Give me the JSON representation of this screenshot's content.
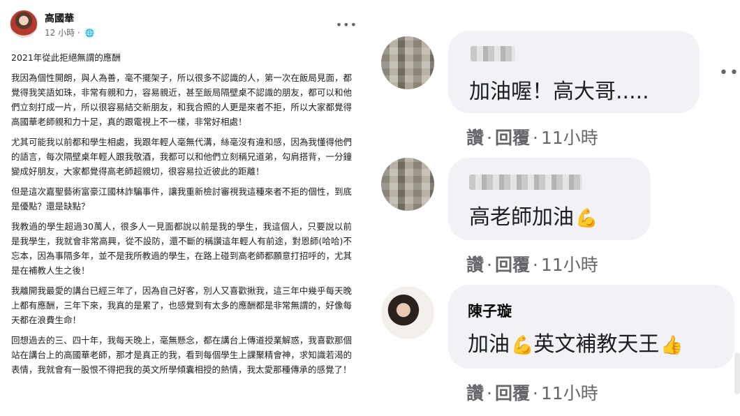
{
  "post": {
    "author": "高國華",
    "time": "12 小時",
    "globe_icon": "globe-icon",
    "title": "2021年從此拒絕無謂的應酬",
    "paragraphs": [
      "我因為個性開朗，與人為善，毫不擺架子，所以很多不認識的人，第一次在飯局見面，都覺得我笑語如珠，非常有親和力，容易親近，甚至飯局隔壁桌不認識的朋友，都可以和他們立刻打成一片，所以很容易結交新朋友，和我合照的人更是來者不拒，所以大家都覺得高國華老師親和力十足，真的跟電視上不一樣，非常好相處！",
      "尤其可能我以前都和學生相處，我跟年輕人毫無代溝，絲毫沒有違和感，因為我懂得他們的語言，每次隔壁桌年輕人跟我敬酒，我都可以和他們立刻稱兄道弟，勾肩搭背，一分鐘變成好朋友，大家都覺得高老師超親切，很容易拉近彼此的距離！",
      "但是這次嘉聖藝術富豪江國林詐騙事件，讓我重新檢討審視我這種來者不拒的個性，到底是優點？還是缺點？",
      "我教過的學生超過30萬人，很多人一見面都說以前是我的學生，我這個人，只要說以前是我學生，我就會非常高興，從不設防，還不斷的稱讚這年輕人有前途，對恩師(哈哈)不忘本，因為事隔多年，並不是我所教過的學生，在路上碰到高老師都願意打招呼的，尤其是在補教人生之後！",
      "我離開我最愛的講台已經三年了，因為自己好客，別人又喜歡揪我，這三年中幾乎每天晚上都有應酬，三年下來，我真的是累了，也感覺到有太多的應酬都是非常無謂的，好像每天都在浪費生命！",
      "回想過去的三、四十年，我每天晚上，毫無懸念，都在講台上傳道授業解惑，我喜歡那個站在講台上的高國華老師，那才是真正的我，看到每個學生上課聚精會神，求知識若渴的表情，我就會有一股恨不得把我的英文所學傾囊相授的熱情，我太愛那種傳承的感覺了！"
    ]
  },
  "comments": [
    {
      "avatar_icon": "blurred-avatar",
      "name": "",
      "text": "加油喔！高大哥.....",
      "emojis": [],
      "like_label": "讚",
      "reply_label": "回覆",
      "time": "11小時"
    },
    {
      "avatar_icon": "blurred-avatar",
      "name": "",
      "text": "高老師加油",
      "emojis": [
        "flexed-biceps-icon"
      ],
      "like_label": "讚",
      "reply_label": "回覆",
      "time": "11小時"
    },
    {
      "avatar_icon": "profile-photo",
      "name": "陳子璇",
      "text_part1": "加油",
      "text_part2": "英文補教天王",
      "emojis": [
        "flexed-biceps-icon",
        "thumbs-up-icon"
      ],
      "like_label": "讚",
      "reply_label": "回覆",
      "time": "11小時"
    }
  ],
  "colors": {
    "bubble": "#f0f2f5",
    "secondary_text": "#65676b",
    "emoji_yellow": "#f5b70a"
  }
}
